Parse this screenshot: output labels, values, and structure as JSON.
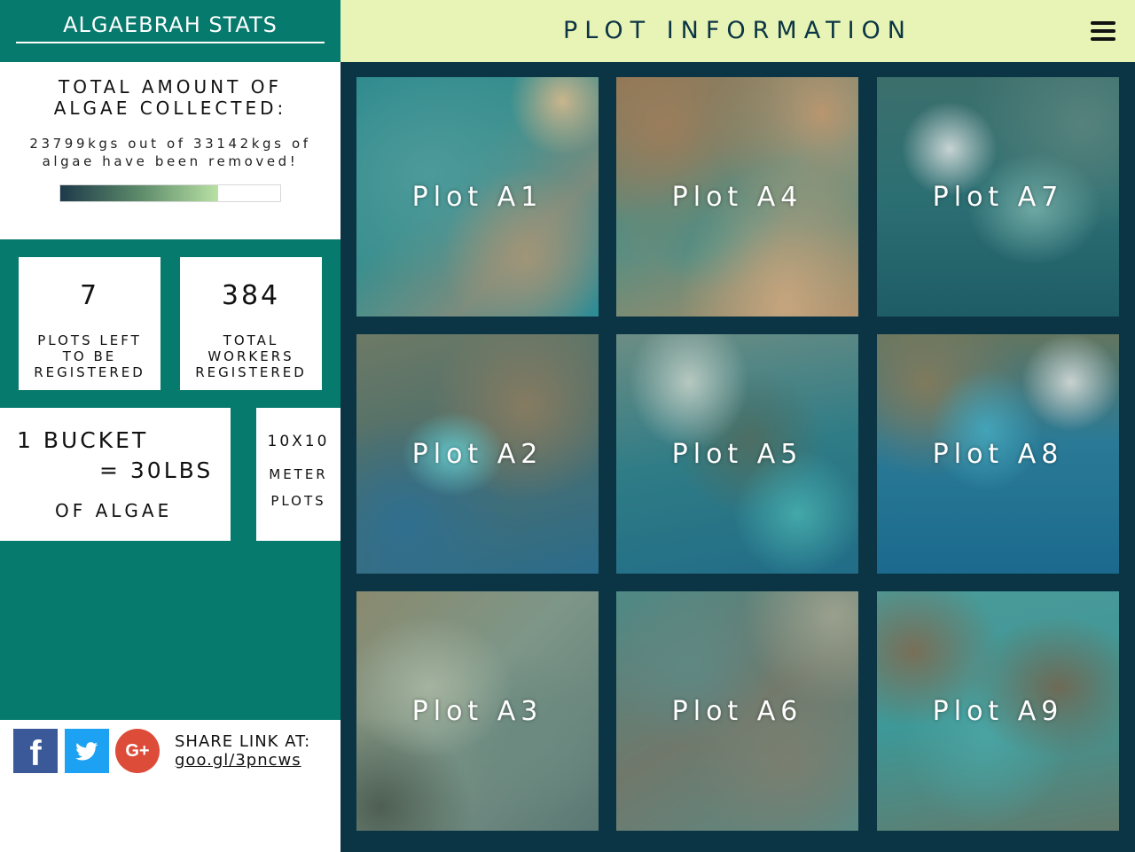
{
  "sidebar": {
    "title": "ALGAEBRAH STATS",
    "algae": {
      "heading_line1": "TOTAL AMOUNT OF",
      "heading_line2": "ALGAE COLLECTED:",
      "desc_line1": "23799kgs out of 33142kgs of",
      "desc_line2": "algae have been removed!",
      "progress_fraction": 0.718
    },
    "stats": {
      "plots_left_value": "7",
      "plots_left_label": [
        "PLOTS LEFT",
        "TO BE",
        "REGISTERED"
      ],
      "workers_value": "384",
      "workers_label": [
        "TOTAL",
        "WORKERS",
        "REGISTERED"
      ]
    },
    "bucket": {
      "line1": "1 BUCKET",
      "line2": "= 30LBS",
      "line3": "OF ALGAE"
    },
    "plot_size": {
      "line1": "10X10",
      "line2": "METER",
      "line3": "PLOTS"
    },
    "share": {
      "label": "SHARE LINK AT:",
      "link": "goo.gl/3pncws",
      "facebook_glyph": "f",
      "google_glyph": "G+"
    }
  },
  "main": {
    "title": "PLOT INFORMATION",
    "menu_icon": "hamburger-icon",
    "plots": [
      {
        "label": "Plot A1"
      },
      {
        "label": "Plot A4"
      },
      {
        "label": "Plot A7"
      },
      {
        "label": "Plot A2"
      },
      {
        "label": "Plot A5"
      },
      {
        "label": "Plot A8"
      },
      {
        "label": "Plot A3"
      },
      {
        "label": "Plot A6"
      },
      {
        "label": "Plot A9"
      }
    ]
  },
  "colors": {
    "teal": "#067a6c",
    "navy": "#0b3544",
    "header_green": "#e8f3b6",
    "facebook": "#3b5998",
    "twitter": "#1da1f2",
    "google": "#dd4b39"
  }
}
